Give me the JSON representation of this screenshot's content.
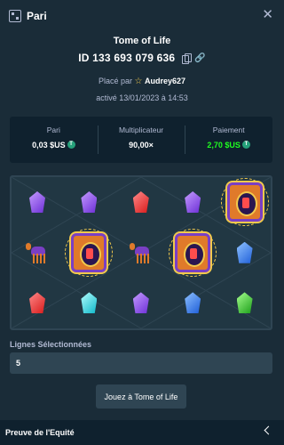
{
  "header": {
    "title": "Pari",
    "icon": "bet-icon",
    "close_icon": "close-icon"
  },
  "game": {
    "name": "Tome of Life",
    "id": "ID 133 693 079 636"
  },
  "placed_by": {
    "prefix": "Placé par",
    "user": "Audrey627"
  },
  "activated": "activé 13/01/2023 à 14:53",
  "stats": {
    "bet": {
      "label": "Pari",
      "value": "0,03 $US"
    },
    "multiplier": {
      "label": "Multiplicateur",
      "value": "90,00×"
    },
    "payout": {
      "label": "Paiement",
      "value": "2,70 $US"
    }
  },
  "board": {
    "rows": [
      [
        "gem-purple",
        "gem-purple",
        "gem-red",
        "gem-purple",
        "tome"
      ],
      [
        "camel",
        "tome",
        "camel",
        "tome",
        "gem-blue"
      ],
      [
        "gem-red",
        "gem-cyan",
        "gem-purple",
        "gem-blue",
        "gem-green"
      ]
    ]
  },
  "lines": {
    "label": "Lignes Sélectionnées",
    "value": "5"
  },
  "play_button": "Jouez à Tome of Life",
  "footer": {
    "label": "Preuve de l'Equité"
  },
  "colors": {
    "background": "#1a2c38",
    "panel": "#0f212e",
    "accent_green": "#1fff20",
    "muted": "#b1bad3"
  }
}
